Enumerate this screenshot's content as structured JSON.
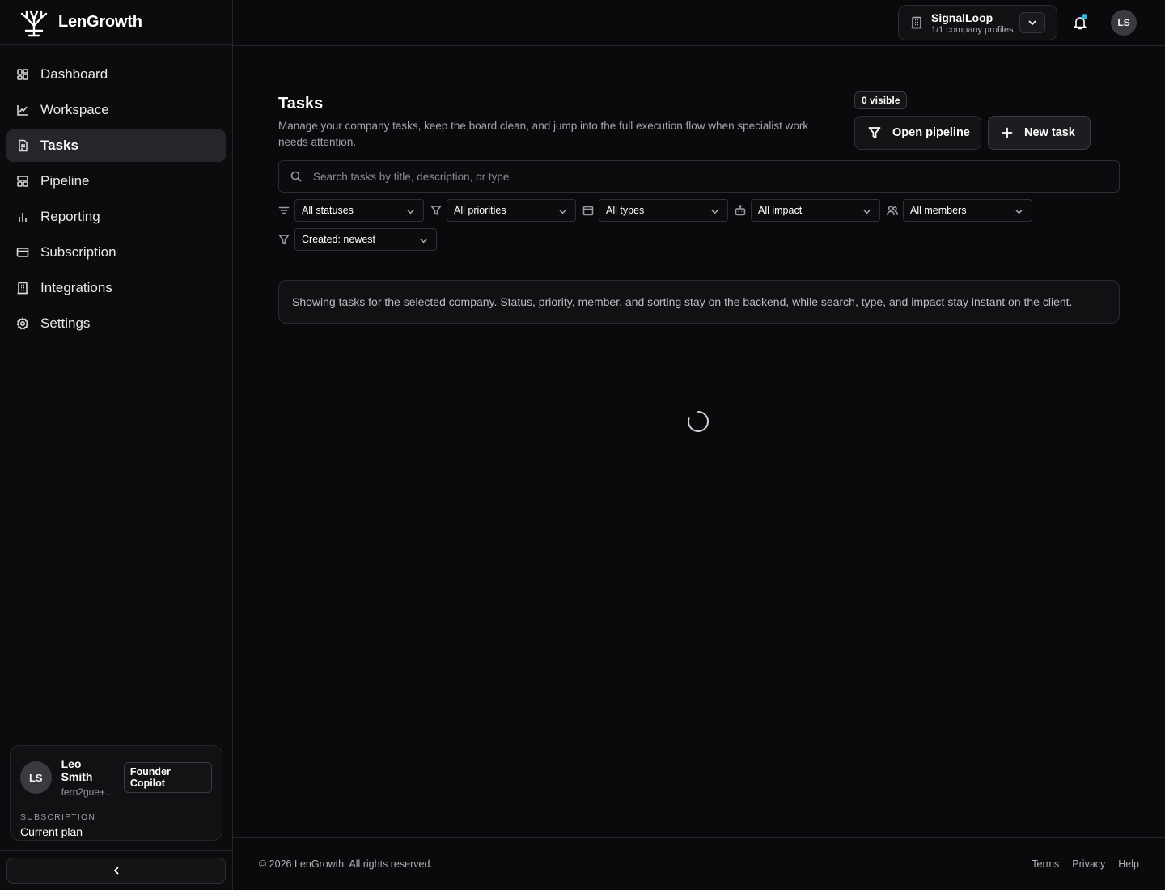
{
  "app": {
    "name": "LenGrowth"
  },
  "sidebar": {
    "items": [
      {
        "label": "Dashboard",
        "icon": "dashboard-icon",
        "active": false
      },
      {
        "label": "Workspace",
        "icon": "chart-line-icon",
        "active": false
      },
      {
        "label": "Tasks",
        "icon": "document-icon",
        "active": true
      },
      {
        "label": "Pipeline",
        "icon": "pipeline-icon",
        "active": false
      },
      {
        "label": "Reporting",
        "icon": "bar-chart-icon",
        "active": false
      },
      {
        "label": "Subscription",
        "icon": "card-icon",
        "active": false
      },
      {
        "label": "Integrations",
        "icon": "building-icon",
        "active": false
      },
      {
        "label": "Settings",
        "icon": "gear-icon",
        "active": false
      }
    ],
    "user": {
      "initials": "LS",
      "name": "Leo Smith",
      "email": "fern2gue+...",
      "badge": "Founder Copilot",
      "subscription_label": "Subscription",
      "subscription_value": "Current plan"
    }
  },
  "topbar": {
    "company_name": "SignalLoop",
    "company_sub": "1/1 company profiles",
    "avatar_initials": "LS",
    "notification_dot_color": "#22b8e6"
  },
  "page": {
    "title": "Tasks",
    "description": "Manage your company tasks, keep the board clean, and jump into the full execution flow when specialist work needs attention.",
    "visible_badge": "0 visible",
    "open_pipeline_label": "Open pipeline",
    "new_task_label": "New task",
    "search_placeholder": "Search tasks by title, description, or type",
    "filters": {
      "status": "All statuses",
      "priority": "All priorities",
      "type": "All types",
      "impact": "All impact",
      "members": "All members",
      "sort": "Created: newest"
    },
    "info": "Showing tasks for the selected company. Status, priority, member, and sorting stay on the backend, while search, type, and impact stay instant on the client."
  },
  "footer": {
    "copyright": "© 2026 LenGrowth. All rights reserved.",
    "links": [
      "Terms",
      "Privacy",
      "Help"
    ]
  }
}
